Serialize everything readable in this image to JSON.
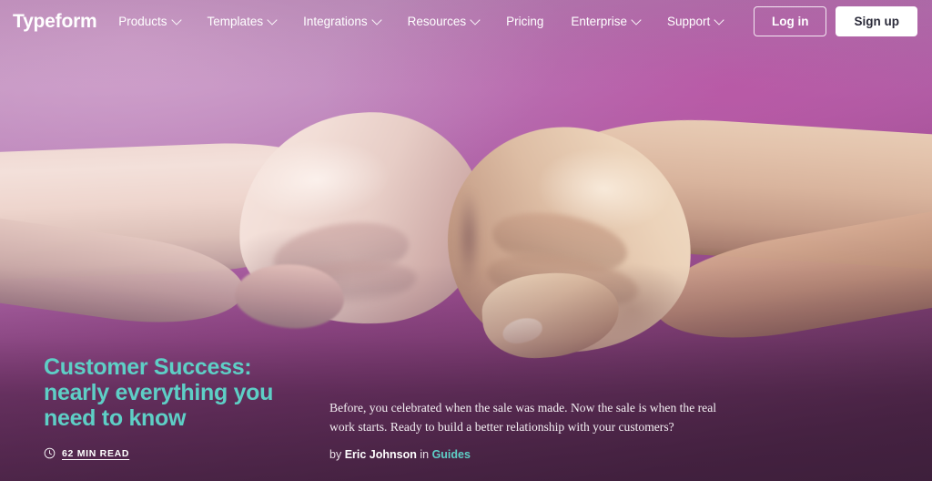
{
  "nav": {
    "logo": "Typeform",
    "links": [
      {
        "label": "Products",
        "has_caret": true,
        "icon": "chevron-down-icon"
      },
      {
        "label": "Templates",
        "has_caret": true,
        "icon": "chevron-down-icon"
      },
      {
        "label": "Integrations",
        "has_caret": true,
        "icon": "chevron-down-icon"
      },
      {
        "label": "Resources",
        "has_caret": true,
        "icon": "chevron-down-icon"
      },
      {
        "label": "Pricing",
        "has_caret": false,
        "icon": ""
      },
      {
        "label": "Enterprise",
        "has_caret": true,
        "icon": "chevron-down-icon"
      },
      {
        "label": "Support",
        "has_caret": true,
        "icon": "chevron-down-icon"
      }
    ],
    "login_label": "Log in",
    "signup_label": "Sign up"
  },
  "hero": {
    "title": "Customer Success: nearly everything you need to know",
    "read_time": "62 MIN READ",
    "clock_icon": "clock-icon",
    "description": "Before, you celebrated when the sale was made. Now the sale is when the real work starts. Ready to build a better relationship with your customers?",
    "byline_prefix": "by",
    "author": "Eric Johnson",
    "byline_connector": "in",
    "category": "Guides",
    "image_alt": "two fists bumping against a purple magenta background"
  },
  "colors": {
    "accent_teal": "#5ecfc6",
    "nav_text": "#ffffff",
    "signup_bg": "#ffffff",
    "signup_text": "#2b2b3a",
    "bg_top": "#c89ac6",
    "bg_bottom": "#4c2c49",
    "bg_magenta": "#be48a0"
  }
}
